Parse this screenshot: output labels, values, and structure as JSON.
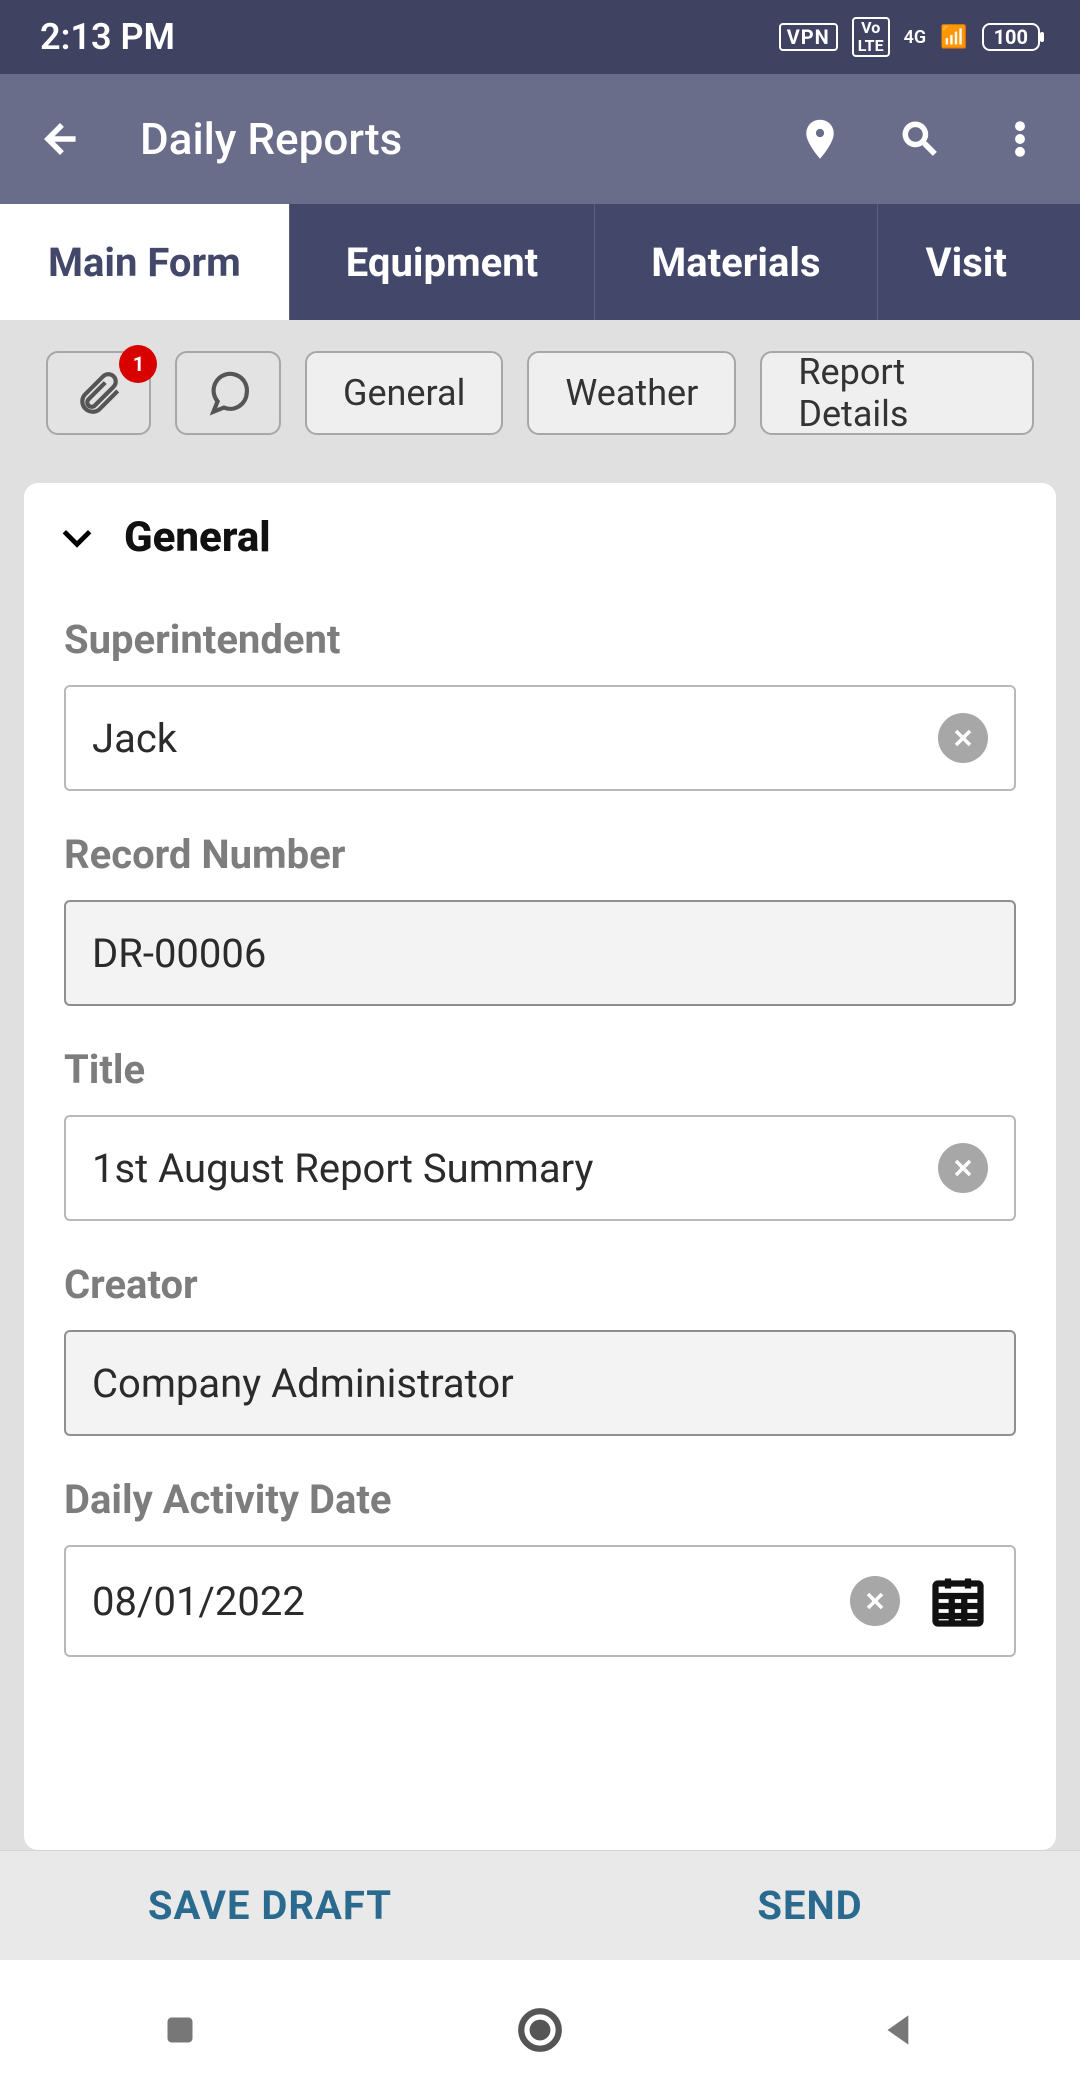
{
  "status": {
    "time": "2:13 PM",
    "vpn": "VPN",
    "volte": "Vo\nLTE",
    "net": "4G",
    "battery": "100"
  },
  "appbar": {
    "title": "Daily Reports"
  },
  "tabs": [
    "Main Form",
    "Equipment",
    "Materials",
    "Visit"
  ],
  "chips": {
    "attach_badge": "1",
    "general": "General",
    "weather": "Weather",
    "report_details": "Report Details"
  },
  "section": {
    "title": "General"
  },
  "fields": {
    "superintendent": {
      "label": "Superintendent",
      "value": "Jack"
    },
    "record_number": {
      "label": "Record Number",
      "value": "DR-00006"
    },
    "title": {
      "label": "Title",
      "value": "1st August Report Summary"
    },
    "creator": {
      "label": "Creator",
      "value": "Company Administrator"
    },
    "daily_activity_date": {
      "label": "Daily Activity Date",
      "value": "08/01/2022"
    }
  },
  "actions": {
    "save_draft": "SAVE DRAFT",
    "send": "SEND"
  }
}
